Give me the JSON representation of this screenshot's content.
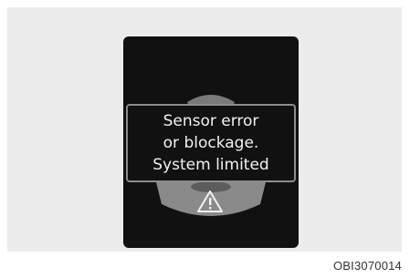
{
  "message": {
    "line1": "Sensor error",
    "line2": "or blockage.",
    "line3": "System limited"
  },
  "icons": {
    "warning": "warning-triangle-icon",
    "sensor": "front-sensor-arc-icon"
  },
  "reference_code": "OBI3070014",
  "colors": {
    "display_background": "#111111",
    "outer_background": "#ececec",
    "text": "#f2f2f2",
    "sensor_arc": "#8a8a8a"
  }
}
